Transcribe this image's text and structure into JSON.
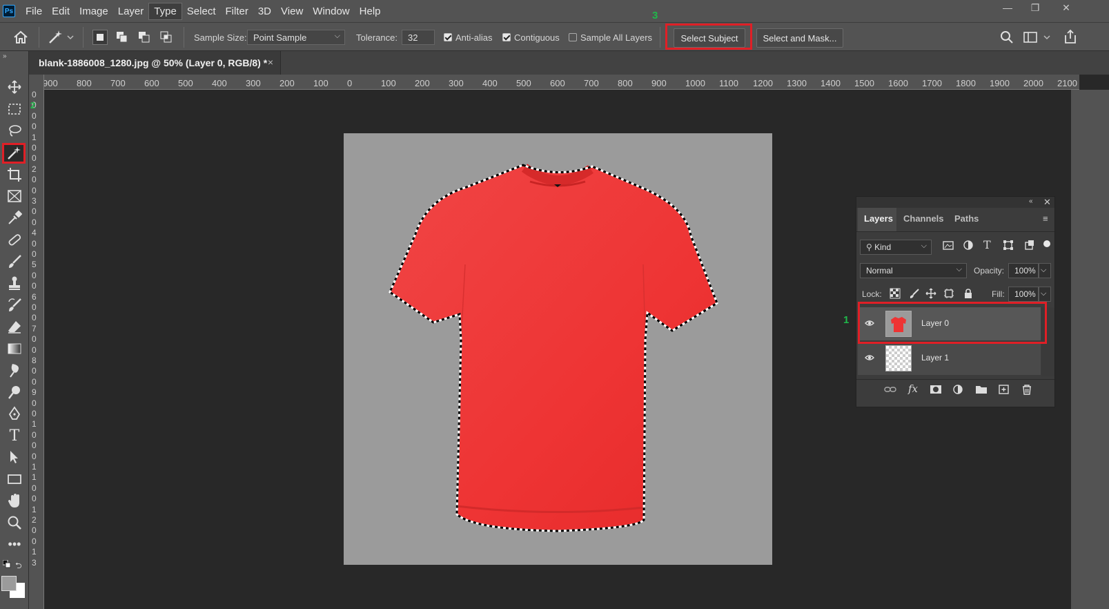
{
  "menubar": {
    "logo": "Ps",
    "items": [
      "File",
      "Edit",
      "Image",
      "Layer",
      "Type",
      "Select",
      "Filter",
      "3D",
      "View",
      "Window",
      "Help"
    ],
    "active_item": "Type",
    "window_controls": [
      "—",
      "❐",
      "✕"
    ]
  },
  "options": {
    "sample_size_label": "Sample Size:",
    "sample_size_value": "Point Sample",
    "tolerance_label": "Tolerance:",
    "tolerance_value": "32",
    "anti_alias_label": "Anti-alias",
    "contiguous_label": "Contiguous",
    "sample_all_layers_label": "Sample All Layers",
    "select_subject_label": "Select Subject",
    "select_and_mask_label": "Select and Mask...",
    "step_number": "3"
  },
  "document": {
    "tab_title": "blank-1886008_1280.jpg @ 50% (Layer 0, RGB/8) *",
    "close_glyph": "×"
  },
  "ruler": {
    "horizontal_ticks": [
      "900",
      "800",
      "700",
      "600",
      "500",
      "400",
      "300",
      "200",
      "100",
      "0",
      "100",
      "200",
      "300",
      "400",
      "500",
      "600",
      "700",
      "800",
      "900",
      "1000",
      "1100",
      "1200",
      "1300",
      "1400",
      "1500",
      "1600",
      "1700",
      "1800",
      "1900",
      "2000",
      "2100"
    ],
    "vertical_ticks": [
      "0",
      "0",
      "0",
      "0",
      "1",
      "0",
      "0",
      "2",
      "0",
      "0",
      "3",
      "0",
      "0",
      "4",
      "0",
      "0",
      "5",
      "0",
      "0",
      "6",
      "0",
      "0",
      "7",
      "0",
      "0",
      "8",
      "0",
      "0",
      "9",
      "0",
      "0",
      "1",
      "0",
      "0",
      "0",
      "1",
      "1",
      "0",
      "0",
      "1",
      "2",
      "0",
      "0",
      "1",
      "3"
    ],
    "vertical_marker": "2"
  },
  "layers_panel": {
    "tabs": [
      "Layers",
      "Channels",
      "Paths"
    ],
    "filter_label": "Kind",
    "blend_mode": "Normal",
    "opacity_label": "Opacity:",
    "opacity_value": "100%",
    "lock_label": "Lock:",
    "fill_label": "Fill:",
    "fill_value": "100%",
    "layers": [
      {
        "name": "Layer 0",
        "selected": true
      },
      {
        "name": "Layer 1",
        "selected": false
      }
    ],
    "step_number": "1"
  },
  "colors": {
    "highlight_red": "#e01f26",
    "step_green": "#1fb84a",
    "shirt_red": "#ee3535",
    "artboard_gray": "#9b9b9b"
  }
}
